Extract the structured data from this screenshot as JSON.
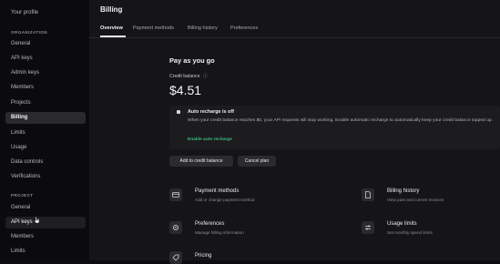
{
  "sidebar": {
    "profile": "Your profile",
    "org_section": "ORGANIZATION",
    "org_items": [
      {
        "label": "General"
      },
      {
        "label": "API keys"
      },
      {
        "label": "Admin keys"
      },
      {
        "label": "Members"
      },
      {
        "label": "Projects"
      },
      {
        "label": "Billing"
      },
      {
        "label": "Limits"
      },
      {
        "label": "Usage"
      },
      {
        "label": "Data controls"
      },
      {
        "label": "Verifications"
      }
    ],
    "project_section": "PROJECT",
    "project_items": [
      {
        "label": "General"
      },
      {
        "label": "API keys"
      },
      {
        "label": "Members"
      },
      {
        "label": "Limits"
      }
    ]
  },
  "main": {
    "title": "Billing",
    "tabs": [
      {
        "label": "Overview"
      },
      {
        "label": "Payment methods"
      },
      {
        "label": "Billing history"
      },
      {
        "label": "Preferences"
      }
    ],
    "plan_title": "Pay as you go",
    "credit_label": "Credit balance",
    "credit_info_icon": "ⓘ",
    "credit_amount": "$4.51",
    "recharge": {
      "title": "Auto recharge is off",
      "description": "When your credit balance reaches $0, your API requests will stop working. Enable automatic recharge to automatically keep your credit balance topped up.",
      "link": "Enable auto recharge"
    },
    "buttons": {
      "add_credit": "Add to credit balance",
      "cancel_plan": "Cancel plan"
    },
    "cards": [
      {
        "title": "Payment methods",
        "subtitle": "Add or change payment method",
        "icon": "card-icon"
      },
      {
        "title": "Billing history",
        "subtitle": "View past and current invoices",
        "icon": "document-icon"
      },
      {
        "title": "Preferences",
        "subtitle": "Manage billing information",
        "icon": "gear-icon"
      },
      {
        "title": "Usage limits",
        "subtitle": "Set monthly spend limits",
        "icon": "sliders-icon"
      },
      {
        "title": "Pricing",
        "subtitle": "",
        "icon": "pricing-icon"
      }
    ]
  },
  "colors": {
    "accent_link": "#3fb97c",
    "active_sidebar_bg": "#2a2a2e"
  }
}
